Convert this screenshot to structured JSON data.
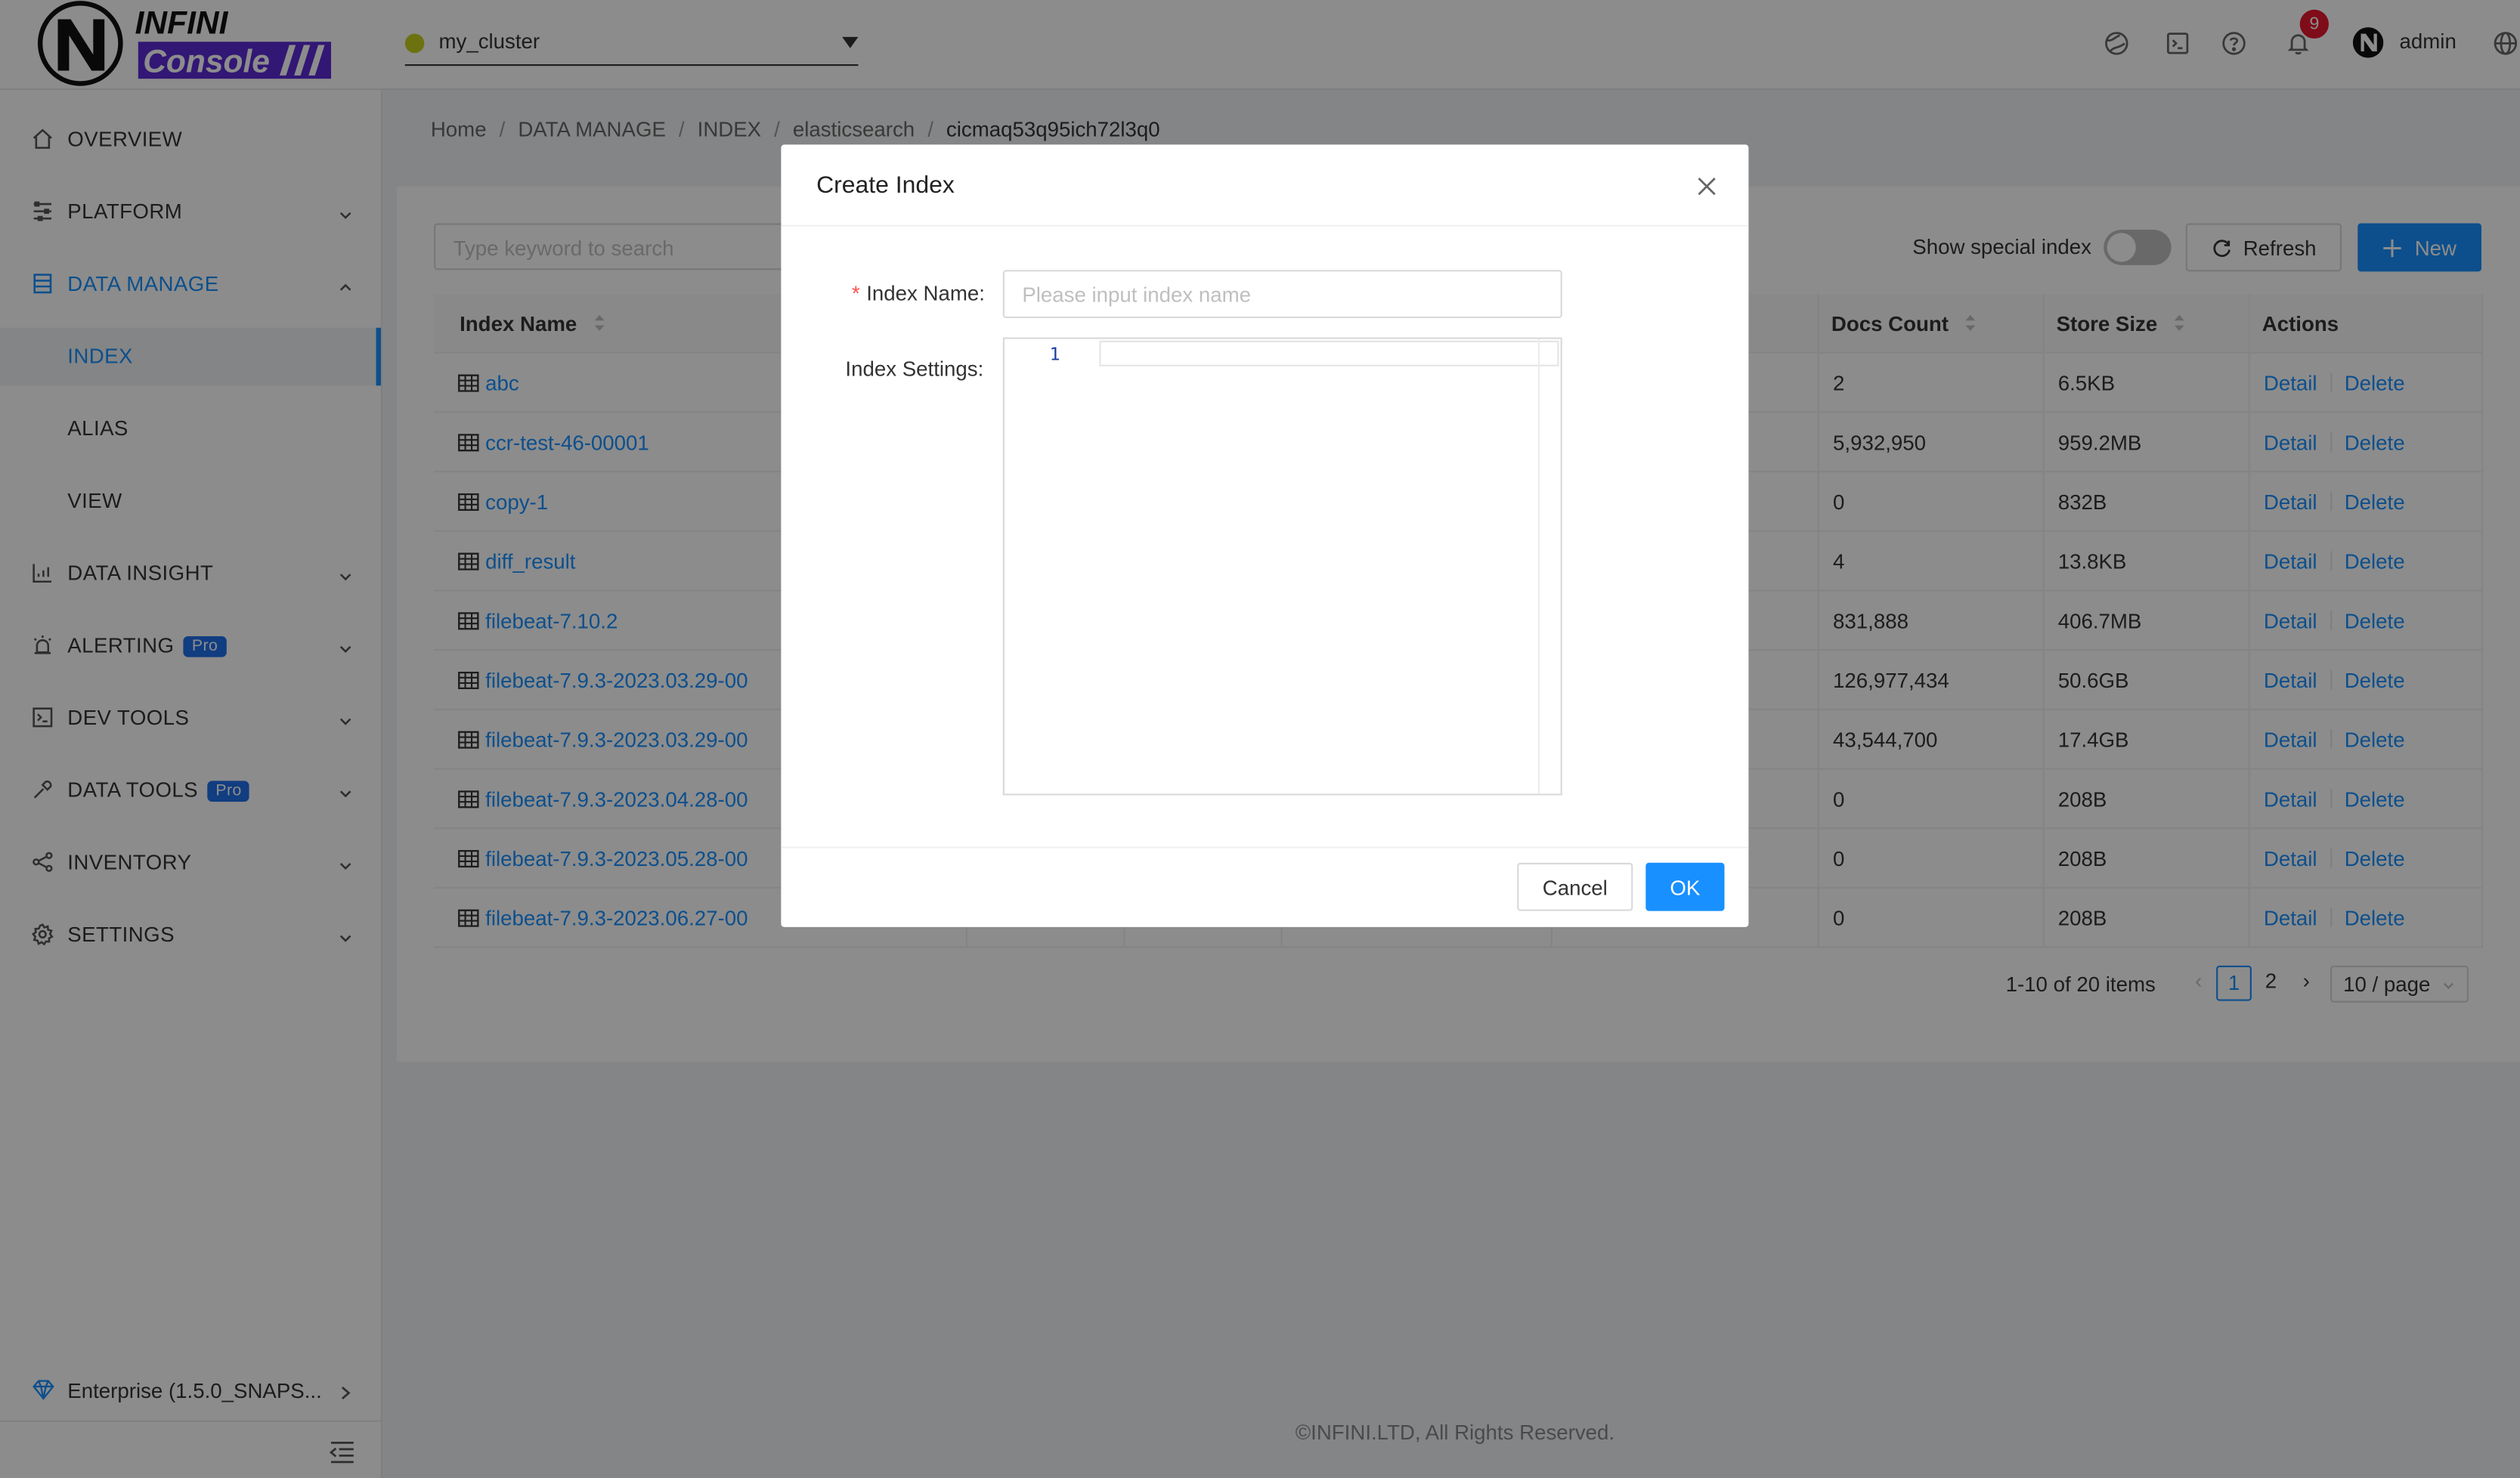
{
  "brand": {
    "top": "INFINI",
    "bottom": "Console"
  },
  "cluster": {
    "name": "my_cluster"
  },
  "header": {
    "notification_count": "9",
    "user": "admin"
  },
  "sidebar": {
    "items": [
      {
        "label": "OVERVIEW"
      },
      {
        "label": "PLATFORM"
      },
      {
        "label": "DATA MANAGE"
      },
      {
        "label": "INDEX"
      },
      {
        "label": "ALIAS"
      },
      {
        "label": "VIEW"
      },
      {
        "label": "DATA INSIGHT"
      },
      {
        "label": "ALERTING",
        "tag": "Pro"
      },
      {
        "label": "DEV TOOLS"
      },
      {
        "label": "DATA TOOLS",
        "tag": "Pro"
      },
      {
        "label": "INVENTORY"
      },
      {
        "label": "SETTINGS"
      }
    ],
    "edition": "Enterprise (1.5.0_SNAPS..."
  },
  "breadcrumb": [
    "Home",
    "DATA MANAGE",
    "INDEX",
    "elasticsearch",
    "cicmaq53q95ich72l3q0"
  ],
  "toolbar": {
    "search_placeholder": "Type keyword to search",
    "show_special_label": "Show special index",
    "refresh_label": "Refresh",
    "new_label": "New"
  },
  "table": {
    "headers": {
      "index_name": "Index Name",
      "docs_count": "Docs Count",
      "store_size": "Store Size",
      "actions": "Actions"
    },
    "rows": [
      {
        "name": "abc",
        "docs": "2",
        "size": "6.5KB"
      },
      {
        "name": "ccr-test-46-00001",
        "docs": "5,932,950",
        "size": "959.2MB"
      },
      {
        "name": "copy-1",
        "docs": "0",
        "size": "832B"
      },
      {
        "name": "diff_result",
        "docs": "4",
        "size": "13.8KB"
      },
      {
        "name": "filebeat-7.10.2",
        "docs": "831,888",
        "size": "406.7MB"
      },
      {
        "name": "filebeat-7.9.3-2023.03.29-00",
        "docs": "126,977,434",
        "size": "50.6GB"
      },
      {
        "name": "filebeat-7.9.3-2023.03.29-00",
        "docs": "43,544,700",
        "size": "17.4GB"
      },
      {
        "name": "filebeat-7.9.3-2023.04.28-00",
        "docs": "0",
        "size": "208B"
      },
      {
        "name": "filebeat-7.9.3-2023.05.28-00",
        "docs": "0",
        "size": "208B"
      },
      {
        "name": "filebeat-7.9.3-2023.06.27-00",
        "docs": "0",
        "size": "208B"
      }
    ],
    "detail_label": "Detail",
    "delete_label": "Delete"
  },
  "pagination": {
    "summary": "1-10 of 20 items",
    "pages": [
      "1",
      "2"
    ],
    "page_size": "10 / page"
  },
  "footer": "©INFINI.LTD, All Rights Reserved.",
  "modal": {
    "title": "Create Index",
    "index_name_label": "Index Name",
    "index_name_placeholder": "Please input index name",
    "index_settings_label": "Index Settings",
    "line_number": "1",
    "cancel_label": "Cancel",
    "ok_label": "OK"
  },
  "colors": {
    "accent": "#1890ff",
    "brand_purple": "#5b2bd6",
    "danger": "#e8172f"
  }
}
